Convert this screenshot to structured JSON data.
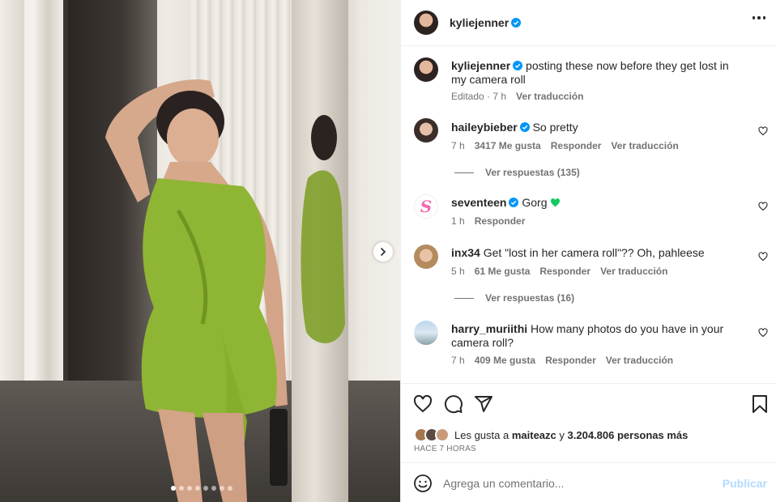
{
  "post": {
    "author": "kyliejenner",
    "caption_user": "kyliejenner",
    "caption_text": "posting these now before they get lost in my camera roll",
    "caption_meta_edited": "Editado · 7 h",
    "caption_meta_translate": "Ver traducción"
  },
  "carousel": {
    "slide_count": 8,
    "active_index": 0
  },
  "comments": [
    {
      "user": "haileybieber",
      "verified": true,
      "text": "So pretty",
      "time": "7 h",
      "likes": "3417 Me gusta",
      "reply": "Responder",
      "translate": "Ver traducción",
      "view_replies": "Ver respuestas (135)"
    },
    {
      "user": "seventeen",
      "verified": true,
      "text": "Gorg",
      "time": "1 h",
      "reply": "Responder"
    },
    {
      "user": "inx34",
      "verified": false,
      "text": "Get \"lost in her camera roll\"?? Oh, pahleese",
      "time": "5 h",
      "likes": "61 Me gusta",
      "reply": "Responder",
      "translate": "Ver traducción",
      "view_replies": "Ver respuestas (16)"
    },
    {
      "user": "harry_muriithi",
      "verified": false,
      "text": "How many photos do you have in your camera roll?",
      "time": "7 h",
      "likes": "409 Me gusta",
      "reply": "Responder",
      "translate": "Ver traducción"
    }
  ],
  "likes": {
    "prefix": "Les gusta a",
    "user": "maiteazc",
    "connector": "y",
    "others": "3.204.806 personas más"
  },
  "timestamp": "HACE 7 HORAS",
  "comment_box": {
    "placeholder": "Agrega un comentario...",
    "publish": "Publicar"
  },
  "colors": {
    "verified": "#0095f6",
    "green_heart": "#12c95e",
    "publish_disabled": "#b3dbff"
  },
  "icons": [
    "more-icon",
    "heart-icon",
    "comment-icon",
    "share-icon",
    "save-icon",
    "emoji-icon",
    "chevron-right-icon"
  ]
}
